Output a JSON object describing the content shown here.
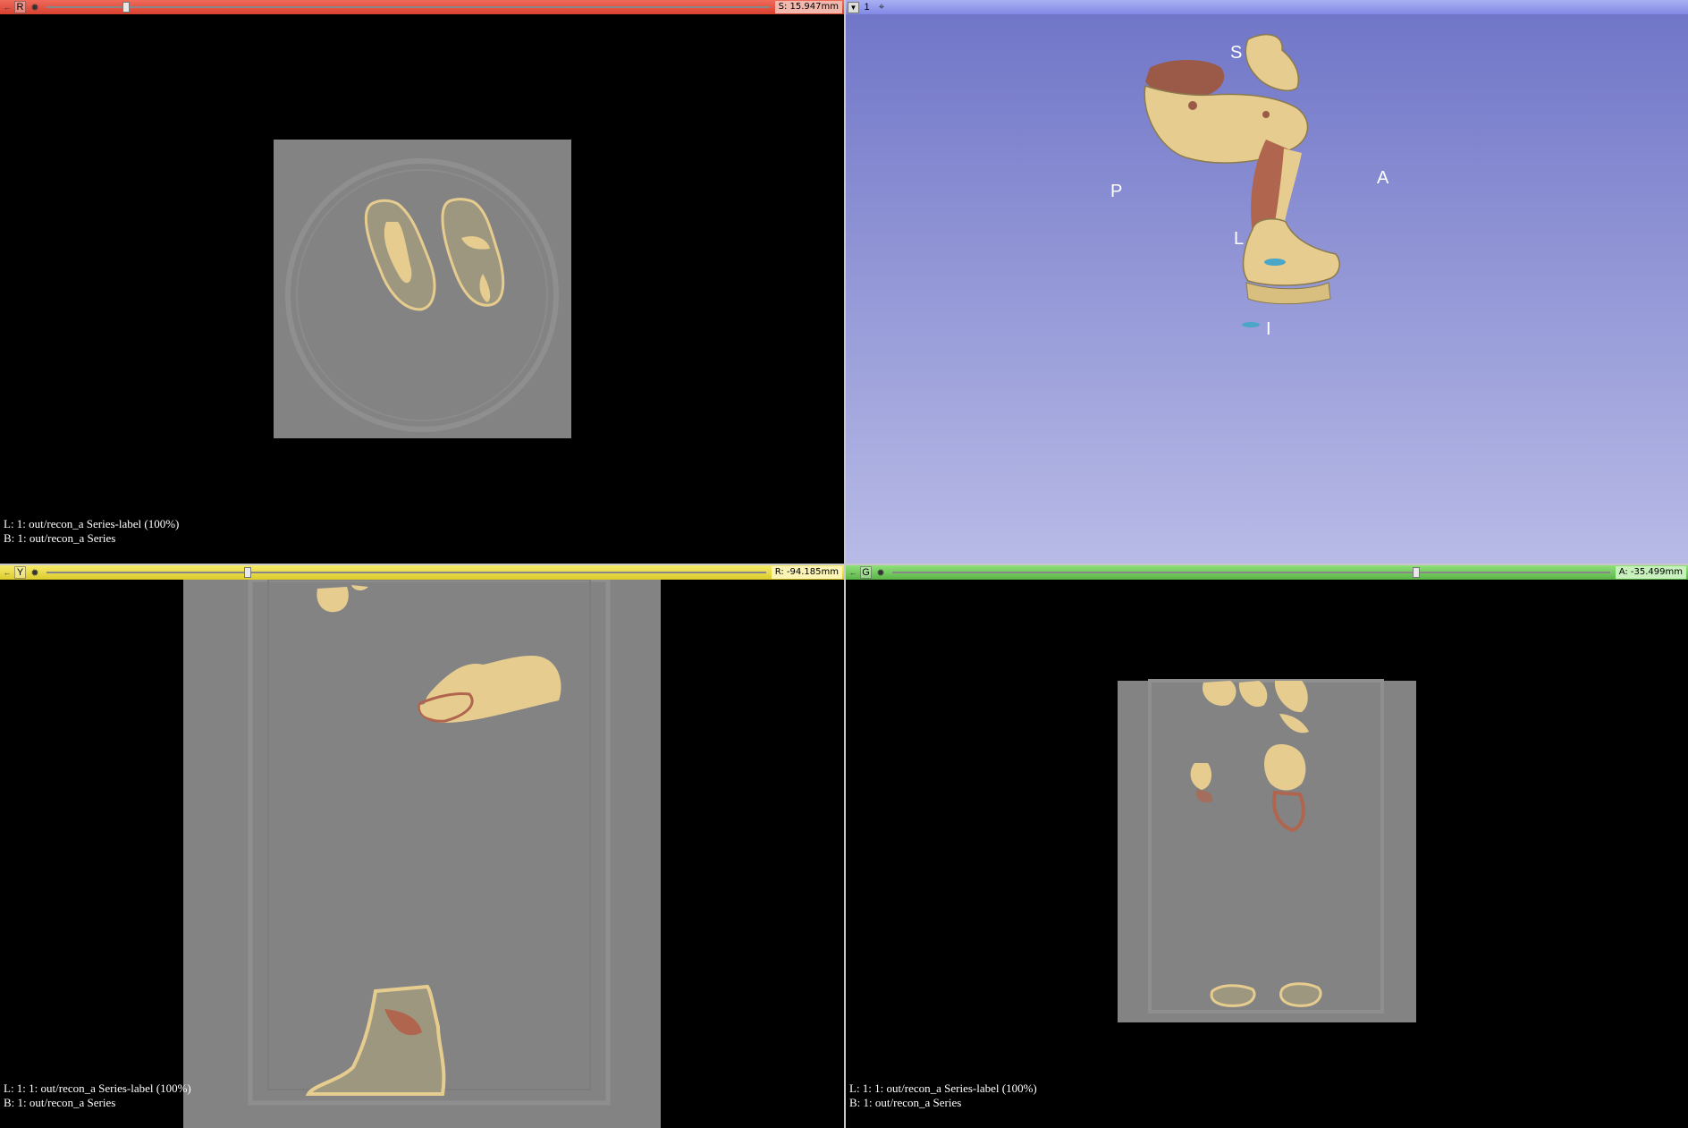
{
  "views": {
    "red": {
      "letter": "R",
      "offset_label": "S: 15.947mm",
      "slider_position": 0.11,
      "overlay_label_line": "L: 1: out/recon_a Series-label (100%)",
      "overlay_background_line": "B: 1: out/recon_a Series",
      "color": "#e04a38"
    },
    "threeD": {
      "number": "1",
      "orientation": {
        "superior": "S",
        "posterior": "P",
        "anterior": "A",
        "left": "L",
        "inferior": "I"
      },
      "color": "#8a90e6"
    },
    "yellow": {
      "letter": "Y",
      "offset_label": "R: -94.185mm",
      "slider_position": 0.28,
      "overlay_label_line": "L: 1: 1: out/recon_a Series-label (100%)",
      "overlay_background_line": "B: 1: out/recon_a Series",
      "color": "#e6d537"
    },
    "green": {
      "letter": "G",
      "offset_label": "A: -35.499mm",
      "slider_position": 0.73,
      "overlay_label_line": "L: 1: 1: out/recon_a Series-label (100%)",
      "overlay_background_line": "B: 1: out/recon_a Series",
      "color": "#6cc158"
    }
  },
  "icons": {
    "pin": "pin-icon",
    "gear": "gear-icon",
    "blue_button": "view-controller-button"
  },
  "segment_colors": {
    "bone": "#e6cd8f",
    "muscle": "#b0654e",
    "vessel": "#4aa7c8"
  }
}
